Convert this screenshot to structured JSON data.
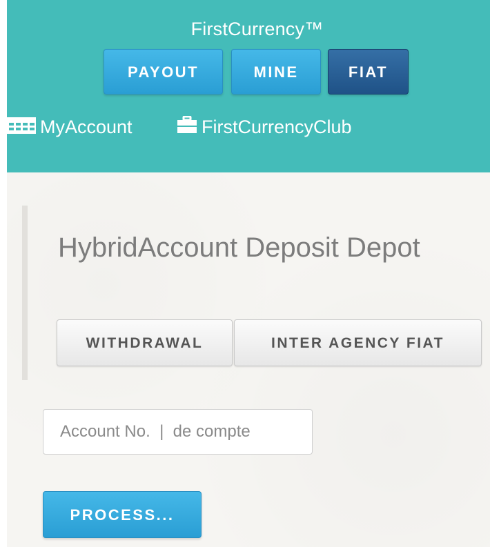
{
  "header": {
    "brand": "FirstCurrency™",
    "nav": {
      "payout": "PAYOUT",
      "mine": "MINE",
      "fiat": "FIAT"
    },
    "links": {
      "account": "MyAccount",
      "club": "FirstCurrencyClub"
    },
    "icons": {
      "account": "calendar-icon",
      "club": "briefcase-icon"
    }
  },
  "main": {
    "title": "HybridAccount Deposit Depot",
    "tabs": {
      "withdrawal": "WITHDRAWAL",
      "inter_agency": "INTER AGENCY FIAT"
    },
    "account_input": {
      "placeholder": "Account No.  |  de compte",
      "value": ""
    },
    "process": "PROCESS..."
  },
  "colors": {
    "header_bg": "#44bcb9",
    "primary_button": "#2a9ed4",
    "active_button": "#1f5287",
    "content_bg": "#f6f5f2"
  }
}
